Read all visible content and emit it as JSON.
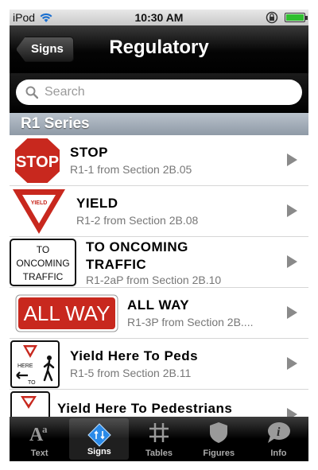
{
  "status_bar": {
    "carrier": "iPod",
    "time": "10:30 AM"
  },
  "nav": {
    "back_label": "Signs",
    "title": "Regulatory"
  },
  "search": {
    "placeholder": "Search"
  },
  "section": {
    "title": "R1 Series"
  },
  "signs": {
    "stop_text": "STOP",
    "yield_text": "YIELD",
    "oncoming_lines": [
      "TO",
      "ONCOMING",
      "TRAFFIC"
    ],
    "allway_text": "ALL WAY",
    "here_text": "HERE",
    "to_text": "TO"
  },
  "rows": [
    {
      "title": "STOP",
      "subtitle": "R1-1 from Section 2B.05"
    },
    {
      "title": "YIELD",
      "subtitle": "R1-2 from Section 2B.08"
    },
    {
      "title_line1": "TO ONCOMING",
      "title_line2": "TRAFFIC",
      "subtitle": "R1-2aP from Section 2B.10"
    },
    {
      "title": "ALL WAY",
      "subtitle": "R1-3P from Section 2B...."
    },
    {
      "title": "Yield Here To Peds",
      "subtitle": "R1-5 from Section 2B.11"
    },
    {
      "title": "Yield Here To Pedestrians",
      "subtitle": ""
    }
  ],
  "tabs": [
    {
      "label": "Text",
      "icon": "text-aa-icon"
    },
    {
      "label": "Signs",
      "icon": "signs-diamond-icon",
      "active": true
    },
    {
      "label": "Tables",
      "icon": "grid-icon"
    },
    {
      "label": "Figures",
      "icon": "shield-icon"
    },
    {
      "label": "Info",
      "icon": "info-bubble-icon"
    }
  ],
  "colors": {
    "sign_red": "#c8281e",
    "nav_black": "#000000",
    "section_blue_gray": "#9aa5b1"
  }
}
